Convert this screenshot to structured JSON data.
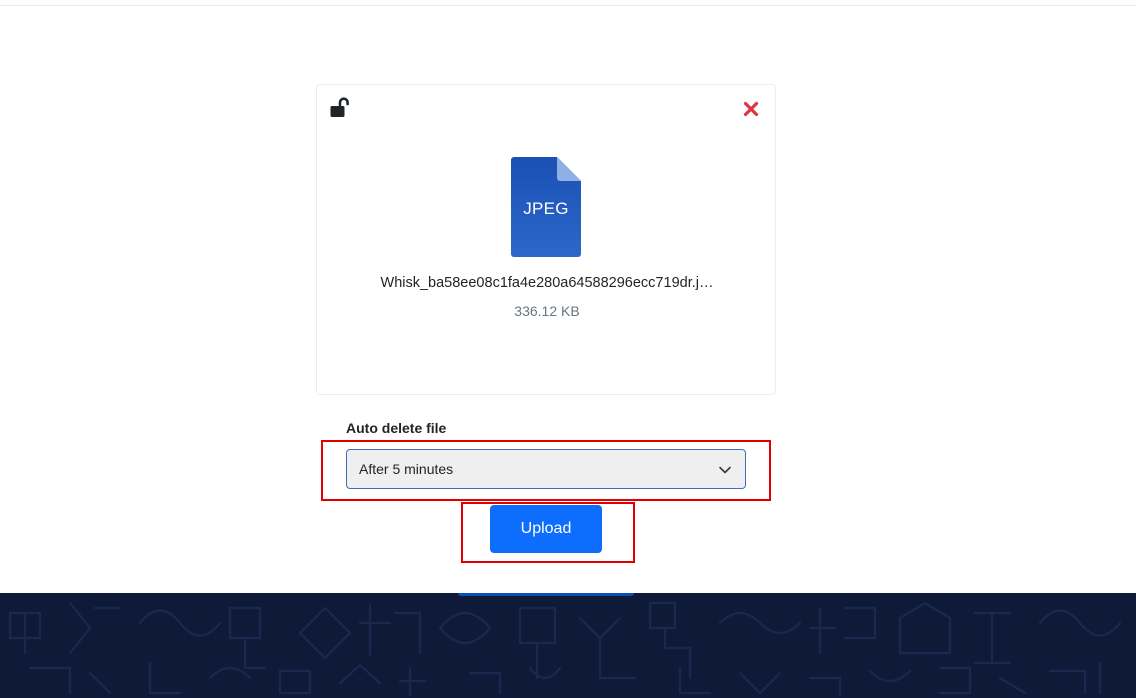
{
  "file_card": {
    "lock_icon": "unlock-icon",
    "remove_icon": "close-icon",
    "file_type": "JPEG",
    "file_name": "Whisk_ba58ee08c1fa4e280a64588296ecc719dr.j…",
    "file_size": "336.12 KB"
  },
  "auto_delete": {
    "label": "Auto delete file",
    "selected": "After 5 minutes"
  },
  "upload": {
    "label": "Upload"
  },
  "colors": {
    "primary": "#0d6efd",
    "danger": "#dc3545",
    "highlight": "#e00000",
    "footer": "#0e1a38",
    "file_icon": "#1f5bbd"
  }
}
